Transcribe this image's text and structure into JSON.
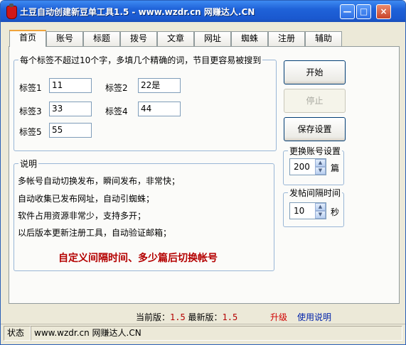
{
  "window": {
    "title": "土豆自动创建新豆单工具1.5 - www.wzdr.cn 网赚达人.CN",
    "minimize": "—",
    "maximize": "□",
    "close": "×"
  },
  "tabs": [
    "首页",
    "账号",
    "标题",
    "拨号",
    "文章",
    "网址",
    "蜘蛛",
    "注册",
    "辅助"
  ],
  "tags": {
    "legend": "每个标签不超过10个字，多填几个精确的词，节目更容易被搜到",
    "items": [
      {
        "label": "标签1",
        "value": "11"
      },
      {
        "label": "标签2",
        "value": "22是"
      },
      {
        "label": "标签3",
        "value": "33"
      },
      {
        "label": "标签4",
        "value": "44"
      },
      {
        "label": "标签5",
        "value": "55"
      }
    ]
  },
  "description": {
    "legend": "说明",
    "lines": [
      "多帐号自动切换发布，瞬间发布，非常快；",
      "自动收集已发布网址，自动引蜘蛛；",
      "软件占用资源非常少，支持多开；",
      "以后版本更新注册工具，自动验证邮箱；"
    ],
    "banner": "自定义间隔时间、多少篇后切换帐号"
  },
  "actions": {
    "start": "开始",
    "stop": "停止",
    "save": "保存设置"
  },
  "account_switch": {
    "legend": "更换账号设置",
    "value": "200",
    "unit": "篇"
  },
  "post_interval": {
    "legend": "发帖间隔时间",
    "value": "10",
    "unit": "秒"
  },
  "version": {
    "current_label": "当前版：",
    "current": "1.5",
    "latest_label": "最新版：",
    "latest": "1.5",
    "upgrade": "升级",
    "help": "使用说明"
  },
  "status": {
    "label": "状态",
    "text": "www.wzdr.cn 网赚达人.CN"
  }
}
